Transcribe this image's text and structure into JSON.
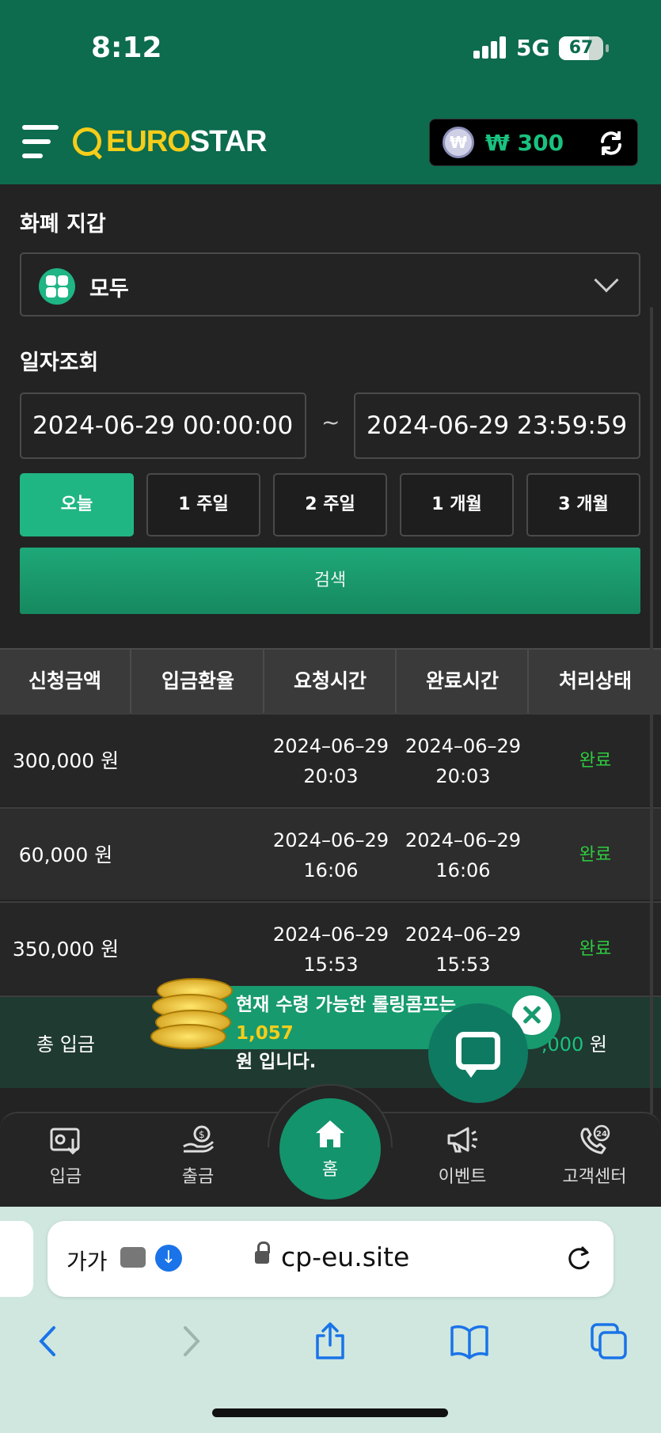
{
  "status": {
    "time": "8:12",
    "network": "5G",
    "battery": "67",
    "battery_level": 0.67
  },
  "header": {
    "logo_accent": "EURO",
    "logo_rest": "STAR",
    "wallet_symbol": "₩",
    "wallet_amount": "₩ 300"
  },
  "filters": {
    "wallet_label": "화폐 지갑",
    "wallet_value": "모두",
    "date_label": "일자조회",
    "start_date": "2024-06-29 00:00:00",
    "end_date": "2024-06-29 23:59:59",
    "separator": "~",
    "periods": [
      "오늘",
      "1 주일",
      "2 주일",
      "1 개월",
      "3 개월"
    ],
    "active_period": "오늘",
    "search_label": "검색"
  },
  "table": {
    "columns": [
      "신청금액",
      "입금환율",
      "요청시간",
      "완료시간",
      "처리상태"
    ],
    "rows": [
      {
        "amount": "300,000 원",
        "rate": "",
        "requested": "2024–06–29\n20:03",
        "completed": "2024–06–29\n20:03",
        "status": "완료"
      },
      {
        "amount": "60,000 원",
        "rate": "",
        "requested": "2024–06–29\n16:06",
        "completed": "2024–06–29\n16:06",
        "status": "완료"
      },
      {
        "amount": "350,000 원",
        "rate": "",
        "requested": "2024–06–29\n15:53",
        "completed": "2024–06–29\n15:53",
        "status": "완료"
      }
    ],
    "total_label": "총 입금",
    "total_value_partial": ",000",
    "total_unit": " 원"
  },
  "toast": {
    "line1": "현재 수령 가능한 롤링콤프는 ",
    "amount": "1,057",
    "line2": "원 입니다."
  },
  "nav": {
    "deposit": "입금",
    "withdraw": "출금",
    "home": "홈",
    "event": "이벤트",
    "support": "고객센터"
  },
  "browser": {
    "text_size": "가가",
    "url": "cp-eu.site"
  },
  "colors": {
    "header_bg": "#0d6b4e",
    "accent_green": "#20b684",
    "status_done": "#2ecc40",
    "logo_yellow": "#f5cd1a"
  }
}
